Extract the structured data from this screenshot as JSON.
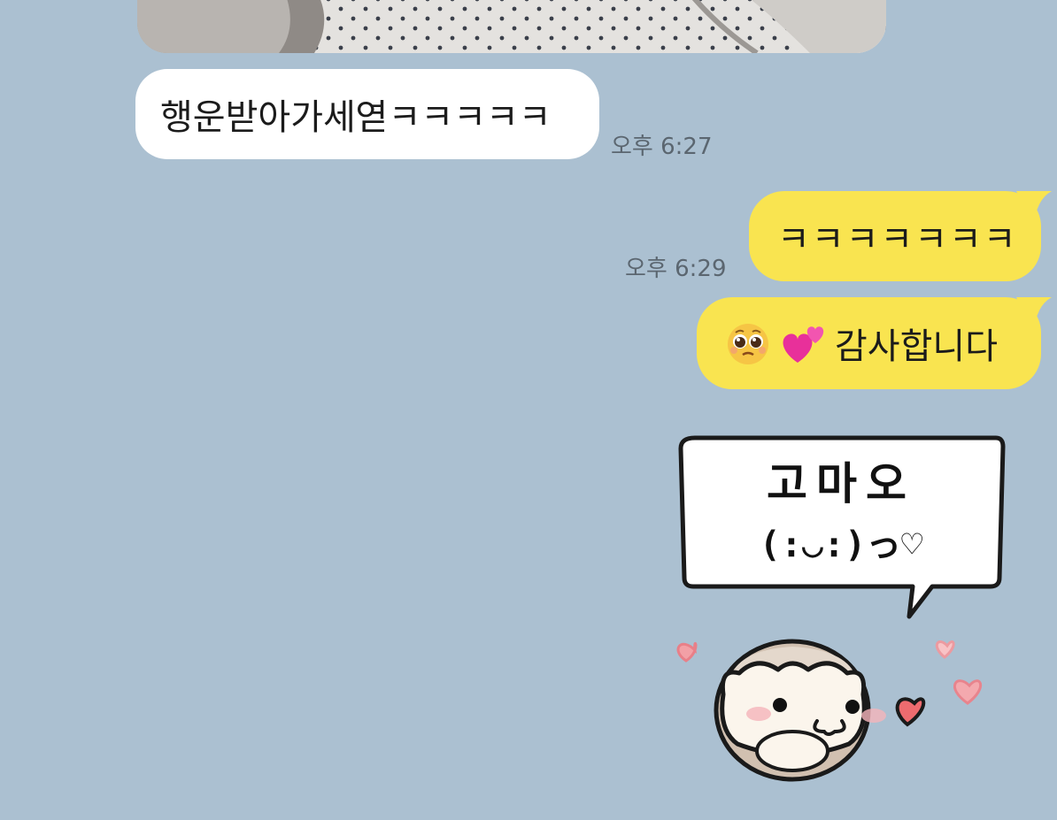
{
  "chat": {
    "background_color": "#abc0d1",
    "incoming_bubble_color": "#ffffff",
    "outgoing_bubble_color": "#f9e450",
    "messages": [
      {
        "direction": "incoming",
        "type": "photo"
      },
      {
        "direction": "incoming",
        "type": "text",
        "text": "행운받아가세엳ㅋㅋㅋㅋㅋ",
        "time": "오후 6:27"
      },
      {
        "direction": "outgoing",
        "type": "text",
        "text": "ㅋㅋㅋㅋㅋㅋㅋ",
        "time": "오후 6:29"
      },
      {
        "direction": "outgoing",
        "type": "text",
        "emojis": [
          "pleading-face-emoji",
          "two-hearts-emoji"
        ],
        "text": "감사합니다"
      },
      {
        "direction": "outgoing",
        "type": "sticker",
        "text": "고마오",
        "face": "(։◡։)っ♡"
      }
    ]
  }
}
